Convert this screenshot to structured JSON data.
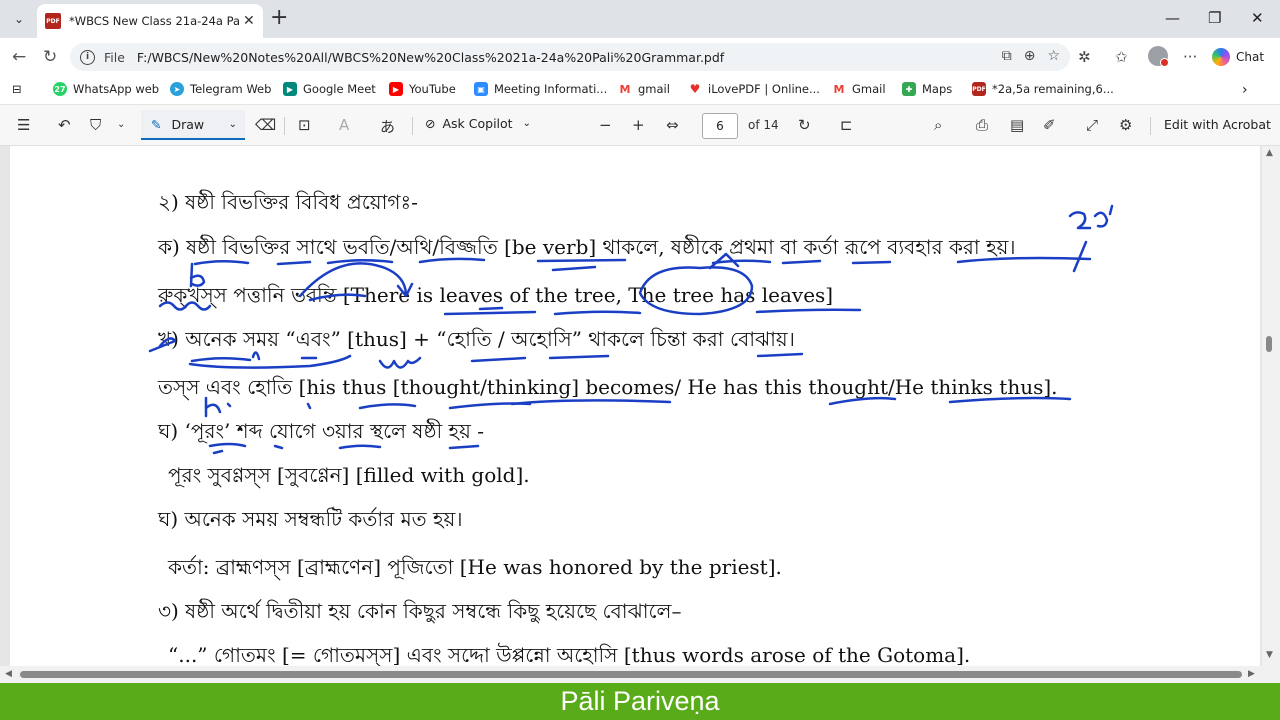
{
  "tab": {
    "title": "*WBCS New Class 21a-24a Pali Gra",
    "favicon": "PDF"
  },
  "address": {
    "scheme_label": "File",
    "url": "F:/WBCS/New%20Notes%20All/WBCS%20New%20Class%2021a-24a%20Pali%20Grammar.pdf"
  },
  "browser": {
    "chat_label": "Chat"
  },
  "bookmarks": [
    {
      "label": "WhatsApp web",
      "icon": "whatsapp-icon",
      "color": "#25d366"
    },
    {
      "label": "Telegram Web",
      "icon": "telegram-icon",
      "color": "#2aa1da"
    },
    {
      "label": "Google Meet",
      "icon": "meet-icon",
      "color": "#00897b"
    },
    {
      "label": "YouTube",
      "icon": "youtube-icon",
      "color": "#ff0000"
    },
    {
      "label": "Meeting Informati...",
      "icon": "zoom-icon",
      "color": "#2d8cff"
    },
    {
      "label": "gmail",
      "icon": "gmail-icon",
      "color": "#ea4335"
    },
    {
      "label": "iLovePDF | Online...",
      "icon": "ilovepdf-icon",
      "color": "#e5322d"
    },
    {
      "label": "Gmail",
      "icon": "gmail-icon",
      "color": "#ea4335"
    },
    {
      "label": "Maps",
      "icon": "maps-icon",
      "color": "#34a853"
    },
    {
      "label": "*2a,5a remaining,6...",
      "icon": "pdf-icon",
      "color": "#b3261e"
    }
  ],
  "pdf_toolbar": {
    "draw_label": "Draw",
    "copilot_label": "Ask Copilot",
    "page_current": "6",
    "page_total_label": "of 14",
    "edit_label": "Edit with Acrobat"
  },
  "document": {
    "lines": [
      "২) ষষ্ঠী বিভক্তির বিবিধ প্রয়োগঃ-",
      "ক) ষষ্ঠী বিভক্তির সাথে ভবতি/অথি/বিজ্জতি [be verb] থাকলে, ষষ্ঠীকে প্রথমা বা কর্তা রূপে ব্যবহার করা হয়।",
      "রুক্খস্স পত্তানি ভবন্তি [There is leaves of the tree, The tree has leaves]",
      "খ) অনেক সময় “এবং” [thus] + “হোতি / অহোসি” থাকলে চিন্তা করা বোঝায়।",
      "তস্স এবং হোতি [his thus [thought/thinking] becomes/ He has this thought/He thinks thus].",
      "ঘ) ‘পূরং’ শব্দ যোগে ৩য়ার স্থলে ষষ্ঠী হয় -",
      "পূরং সুবণ্ণস্স [সুবণ্ণেন] [filled with gold].",
      "ঘ) অনেক সময় সম্বন্ধটি কর্তার মত হয়।",
      "কর্তা: ব্রাহ্মণস্স [ব্রাহ্মণেন] পূজিতো [He was honored by the priest].",
      "৩) ষষ্ঠী অর্থে দ্বিতীয়া হয় কোন কিছুর সম্বন্ধে কিছু হয়েছে বোঝালে–",
      "“...” গোতমং [= গোতমস্স] এবং সদ্দো উপ্পন্নো অহোসি [thus words arose of the Gotoma]."
    ],
    "annotations": [
      "৩য়",
      "6",
      "h"
    ]
  },
  "banner": {
    "text": "Pāli Pariveṇa",
    "color": "#5aab1a"
  },
  "colors": {
    "ink": "#1a3fc4",
    "accent": "#0f6cbd"
  }
}
